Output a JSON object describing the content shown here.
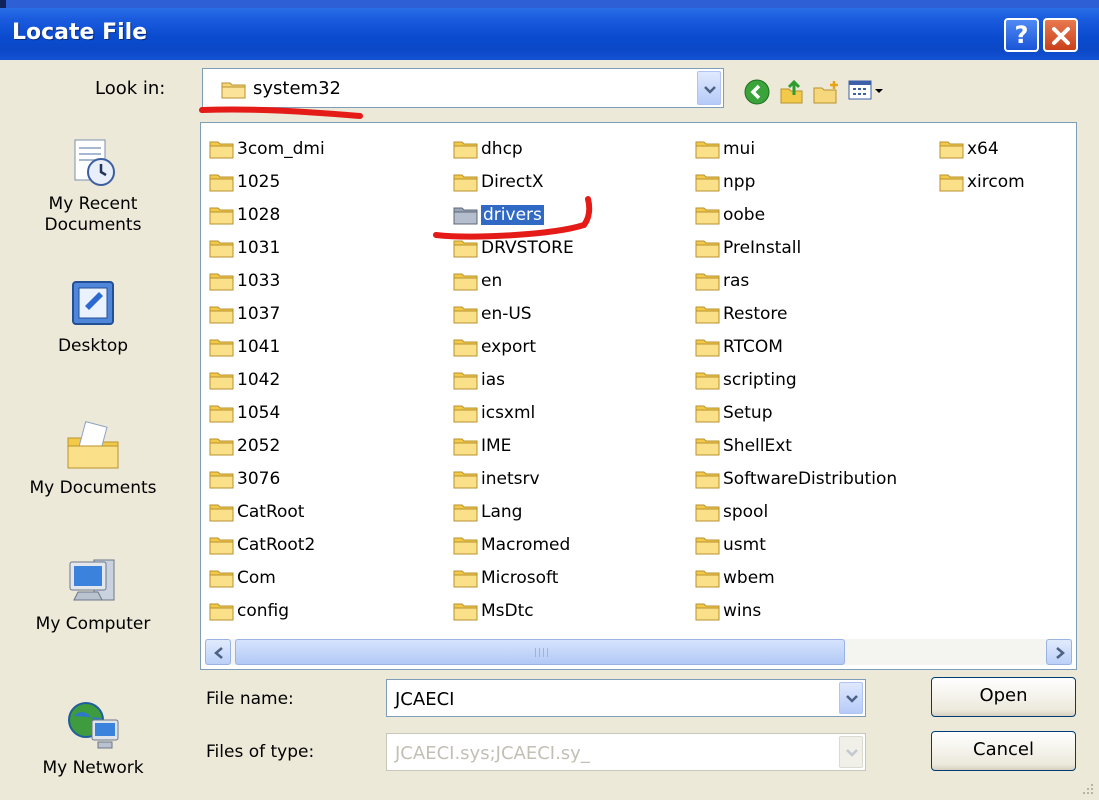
{
  "window": {
    "title": "Locate File"
  },
  "lookin": {
    "label": "Look in:",
    "value": "system32"
  },
  "places": [
    {
      "name": "recent",
      "label": "My Recent Documents"
    },
    {
      "name": "desktop",
      "label": "Desktop"
    },
    {
      "name": "mydocs",
      "label": "My Documents"
    },
    {
      "name": "mycomputer",
      "label": "My Computer"
    },
    {
      "name": "network",
      "label": "My Network"
    }
  ],
  "files": {
    "col1": [
      "3com_dmi",
      "1025",
      "1028",
      "1031",
      "1033",
      "1037",
      "1041",
      "1042",
      "1054",
      "2052",
      "3076",
      "CatRoot",
      "CatRoot2",
      "Com",
      "config"
    ],
    "col2": [
      "dhcp",
      "DirectX",
      "drivers",
      "DRVSTORE",
      "en",
      "en-US",
      "export",
      "ias",
      "icsxml",
      "IME",
      "inetsrv",
      "Lang",
      "Macromed",
      "Microsoft",
      "MsDtc"
    ],
    "col3": [
      "mui",
      "npp",
      "oobe",
      "PreInstall",
      "ras",
      "Restore",
      "RTCOM",
      "scripting",
      "Setup",
      "ShellExt",
      "SoftwareDistribution",
      "spool",
      "usmt",
      "wbem",
      "wins"
    ],
    "col4": [
      "x64",
      "xircom"
    ],
    "selected": "drivers"
  },
  "filename": {
    "label": "File name:",
    "value": "JCAECI"
  },
  "filetype": {
    "label": "Files of type:",
    "value": "JCAECI.sys;JCAECI.sy_"
  },
  "buttons": {
    "open": "Open",
    "cancel": "Cancel"
  },
  "colors": {
    "titlebar": "#0a4bd0",
    "selection": "#316ac5",
    "annotation": "#e41b17"
  }
}
